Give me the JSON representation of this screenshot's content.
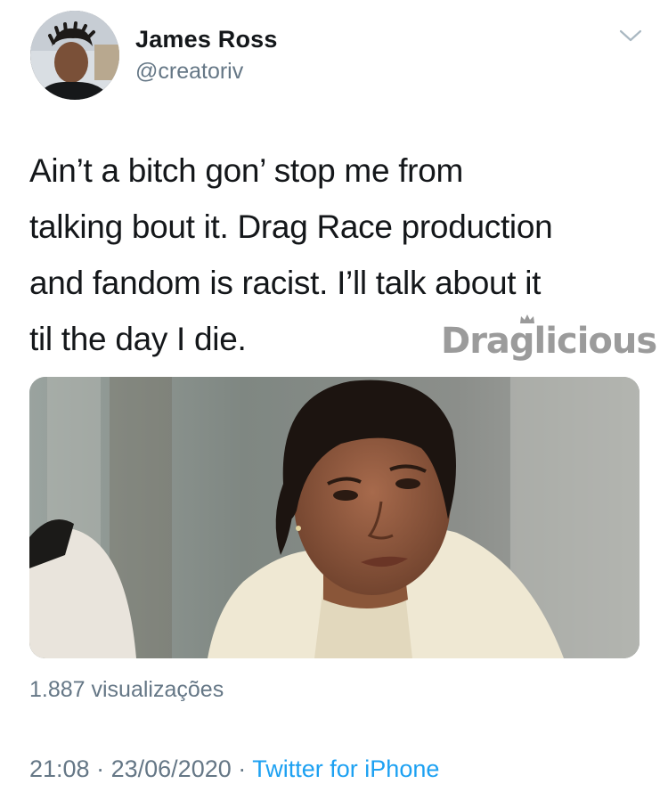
{
  "author": {
    "name": "James Ross",
    "handle": "@creatoriv"
  },
  "tweet": {
    "text": "Ain’t a bitch gon’ stop me from\ntalking bout it. Drag Race production\nand fandom is racist. I’ll talk about it\ntil the day I die."
  },
  "watermark": {
    "text": "Draglicious"
  },
  "media": {
    "views": "1.887 visualizações"
  },
  "meta": {
    "time": "21:08",
    "date": "23/06/2020",
    "separator": "·",
    "source": "Twitter for iPhone"
  },
  "icons": {
    "menu": "chevron-down-icon"
  },
  "colors": {
    "text": "#14171a",
    "secondary": "#657786",
    "link": "#1da1f2"
  }
}
